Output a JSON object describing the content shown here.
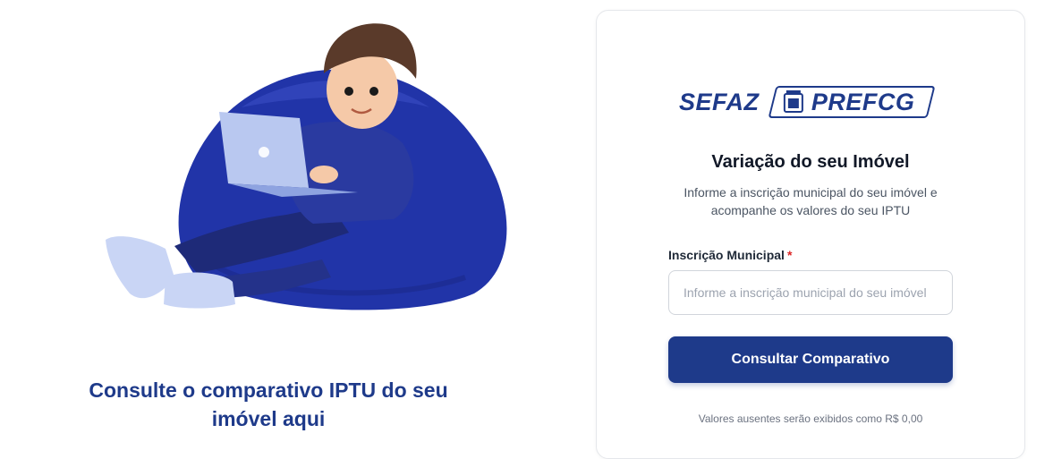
{
  "hero": {
    "tagline_line1": "Consulte o comparativo IPTU do seu",
    "tagline_line2": "imóvel aqui",
    "illustration": "person-on-beanbag-with-laptop"
  },
  "card": {
    "logo_sefaz": "SEFAZ",
    "logo_pref": "PREFCG",
    "title": "Variação do seu Imóvel",
    "subtitle_line1": "Informe a inscrição municipal do seu imóvel e",
    "subtitle_line2": "acompanhe os valores do seu IPTU",
    "field_label": "Inscrição Municipal",
    "required_mark": "*",
    "input_placeholder": "Informe a inscrição municipal do seu imóvel",
    "input_value": "",
    "button_label": "Consultar Comparativo",
    "note": "Valores ausentes serão exibidos como R$ 0,00"
  },
  "colors": {
    "brand": "#1e3a8a",
    "beanbag": "#2134a8",
    "required": "#dc2626"
  }
}
